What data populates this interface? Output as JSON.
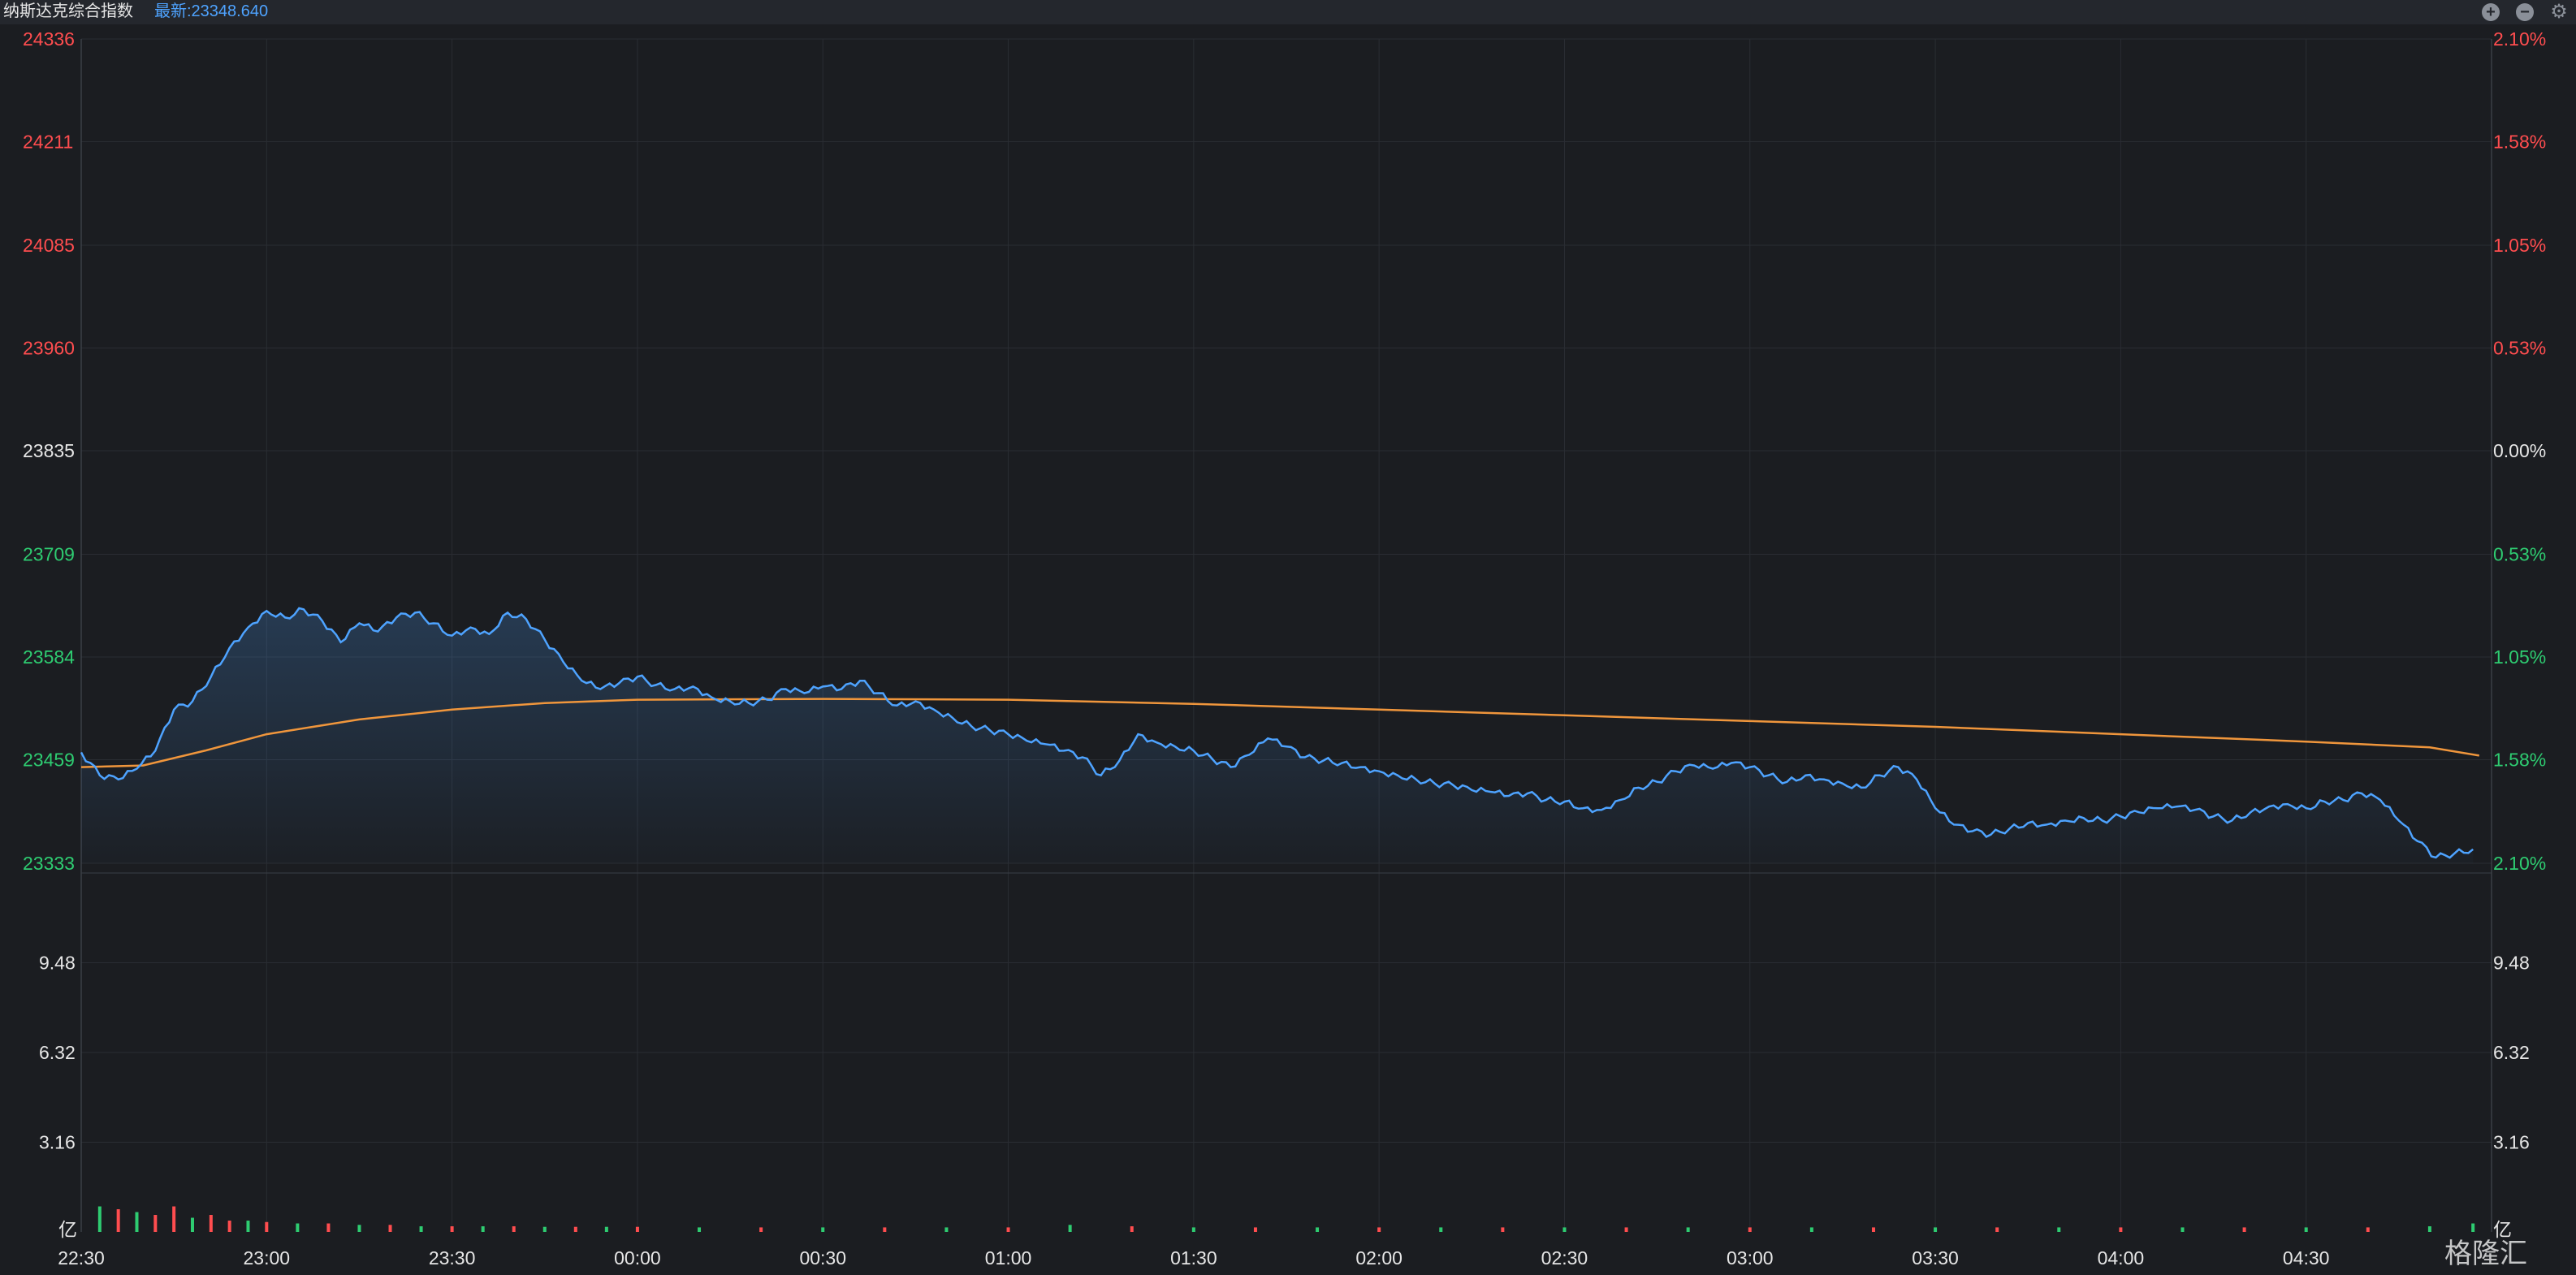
{
  "header": {
    "title": "纳斯达克综合指数",
    "latest_label": "最新:23348.640",
    "zoom_in_icon": "plus-circle-icon",
    "zoom_out_icon": "minus-circle-icon",
    "settings_icon": "gear-icon"
  },
  "colors": {
    "background": "#1b1d21",
    "price_line": "#4ea3ff",
    "avg_line": "#f0963c",
    "up": "#ff4d4f",
    "down": "#2ecc71",
    "neutral": "#e6e6e6",
    "grid": "#2a2d33"
  },
  "watermark": "格隆汇",
  "chart_data": [
    {
      "type": "line",
      "name": "price",
      "x_ticks": [
        "22:30",
        "23:00",
        "23:30",
        "00:00",
        "00:30",
        "01:00",
        "01:30",
        "02:00",
        "02:30",
        "03:00",
        "03:30",
        "04:00",
        "04:30"
      ],
      "x_range": [
        "22:30",
        "05:00"
      ],
      "y_ticks_left": [
        "24336",
        "24211",
        "24085",
        "23960",
        "23835",
        "23709",
        "23584",
        "23459",
        "23333"
      ],
      "y_ticks_right": [
        "2.10%",
        "1.58%",
        "1.05%",
        "0.53%",
        "0.00%",
        "0.53%",
        "1.05%",
        "1.58%",
        "2.10%"
      ],
      "ylim": [
        23333,
        24336
      ],
      "prev_close": 23835,
      "grid": true,
      "price_anchors": [
        [
          "22:30",
          23468
        ],
        [
          "22:33",
          23440
        ],
        [
          "22:36",
          23435
        ],
        [
          "22:39",
          23448
        ],
        [
          "22:42",
          23470
        ],
        [
          "22:45",
          23520
        ],
        [
          "22:48",
          23530
        ],
        [
          "22:51",
          23560
        ],
        [
          "22:54",
          23595
        ],
        [
          "22:57",
          23620
        ],
        [
          "23:00",
          23640
        ],
        [
          "23:03",
          23632
        ],
        [
          "23:06",
          23642
        ],
        [
          "23:09",
          23628
        ],
        [
          "23:12",
          23602
        ],
        [
          "23:15",
          23625
        ],
        [
          "23:18",
          23615
        ],
        [
          "23:21",
          23632
        ],
        [
          "23:24",
          23638
        ],
        [
          "23:27",
          23625
        ],
        [
          "23:30",
          23610
        ],
        [
          "23:33",
          23620
        ],
        [
          "23:36",
          23612
        ],
        [
          "23:39",
          23638
        ],
        [
          "23:42",
          23630
        ],
        [
          "23:45",
          23605
        ],
        [
          "23:48",
          23578
        ],
        [
          "23:51",
          23555
        ],
        [
          "23:54",
          23545
        ],
        [
          "23:57",
          23552
        ],
        [
          "00:00",
          23560
        ],
        [
          "00:03",
          23550
        ],
        [
          "00:06",
          23545
        ],
        [
          "00:09",
          23548
        ],
        [
          "00:12",
          23535
        ],
        [
          "00:15",
          23530
        ],
        [
          "00:18",
          23528
        ],
        [
          "00:21",
          23532
        ],
        [
          "00:24",
          23545
        ],
        [
          "00:27",
          23540
        ],
        [
          "00:30",
          23548
        ],
        [
          "00:33",
          23545
        ],
        [
          "00:36",
          23555
        ],
        [
          "00:39",
          23540
        ],
        [
          "00:42",
          23525
        ],
        [
          "00:45",
          23530
        ],
        [
          "00:48",
          23520
        ],
        [
          "00:51",
          23510
        ],
        [
          "00:54",
          23500
        ],
        [
          "00:57",
          23495
        ],
        [
          "01:00",
          23490
        ],
        [
          "01:03",
          23482
        ],
        [
          "01:06",
          23478
        ],
        [
          "01:09",
          23470
        ],
        [
          "01:12",
          23462
        ],
        [
          "01:15",
          23440
        ],
        [
          "01:18",
          23458
        ],
        [
          "01:21",
          23490
        ],
        [
          "01:24",
          23480
        ],
        [
          "01:27",
          23475
        ],
        [
          "01:30",
          23470
        ],
        [
          "01:33",
          23460
        ],
        [
          "01:36",
          23450
        ],
        [
          "01:39",
          23465
        ],
        [
          "01:42",
          23485
        ],
        [
          "01:45",
          23475
        ],
        [
          "01:48",
          23462
        ],
        [
          "01:51",
          23458
        ],
        [
          "01:54",
          23455
        ],
        [
          "01:57",
          23450
        ],
        [
          "02:00",
          23445
        ],
        [
          "02:03",
          23440
        ],
        [
          "02:06",
          23435
        ],
        [
          "02:09",
          23430
        ],
        [
          "02:12",
          23428
        ],
        [
          "02:15",
          23422
        ],
        [
          "02:18",
          23420
        ],
        [
          "02:21",
          23415
        ],
        [
          "02:24",
          23418
        ],
        [
          "02:27",
          23410
        ],
        [
          "02:30",
          23408
        ],
        [
          "02:33",
          23400
        ],
        [
          "02:36",
          23398
        ],
        [
          "02:39",
          23410
        ],
        [
          "02:42",
          23425
        ],
        [
          "02:45",
          23432
        ],
        [
          "02:48",
          23445
        ],
        [
          "02:51",
          23452
        ],
        [
          "02:54",
          23448
        ],
        [
          "02:57",
          23455
        ],
        [
          "03:00",
          23450
        ],
        [
          "03:03",
          23440
        ],
        [
          "03:06",
          23432
        ],
        [
          "03:09",
          23440
        ],
        [
          "03:12",
          23435
        ],
        [
          "03:15",
          23430
        ],
        [
          "03:18",
          23425
        ],
        [
          "03:21",
          23440
        ],
        [
          "03:24",
          23450
        ],
        [
          "03:27",
          23435
        ],
        [
          "03:30",
          23400
        ],
        [
          "03:33",
          23380
        ],
        [
          "03:36",
          23372
        ],
        [
          "03:39",
          23368
        ],
        [
          "03:42",
          23375
        ],
        [
          "03:45",
          23382
        ],
        [
          "03:48",
          23380
        ],
        [
          "03:51",
          23385
        ],
        [
          "03:54",
          23388
        ],
        [
          "03:57",
          23385
        ],
        [
          "04:00",
          23390
        ],
        [
          "04:03",
          23395
        ],
        [
          "04:06",
          23400
        ],
        [
          "04:09",
          23402
        ],
        [
          "04:12",
          23398
        ],
        [
          "04:15",
          23390
        ],
        [
          "04:18",
          23385
        ],
        [
          "04:21",
          23395
        ],
        [
          "04:24",
          23402
        ],
        [
          "04:27",
          23405
        ],
        [
          "04:30",
          23400
        ],
        [
          "04:33",
          23408
        ],
        [
          "04:36",
          23410
        ],
        [
          "04:39",
          23418
        ],
        [
          "04:42",
          23410
        ],
        [
          "04:45",
          23385
        ],
        [
          "04:48",
          23360
        ],
        [
          "04:51",
          23340
        ],
        [
          "04:54",
          23345
        ],
        [
          "04:57",
          23350
        ]
      ],
      "avg_anchors": [
        [
          "22:30",
          23450
        ],
        [
          "22:40",
          23452
        ],
        [
          "22:50",
          23470
        ],
        [
          "23:00",
          23490
        ],
        [
          "23:15",
          23508
        ],
        [
          "23:30",
          23520
        ],
        [
          "23:45",
          23528
        ],
        [
          "00:00",
          23532
        ],
        [
          "00:30",
          23533
        ],
        [
          "01:00",
          23532
        ],
        [
          "01:30",
          23527
        ],
        [
          "02:00",
          23520
        ],
        [
          "02:30",
          23513
        ],
        [
          "03:00",
          23506
        ],
        [
          "03:30",
          23499
        ],
        [
          "04:00",
          23490
        ],
        [
          "04:30",
          23481
        ],
        [
          "04:50",
          23474
        ],
        [
          "04:58",
          23464
        ]
      ]
    },
    {
      "type": "bar",
      "name": "volume",
      "unit": "亿",
      "y_ticks": [
        "9.48",
        "6.32",
        "3.16",
        "亿"
      ],
      "ylim": [
        0,
        12.64
      ],
      "x_range": [
        "22:30",
        "05:00"
      ],
      "bars": [
        [
          "22:33",
          0.9,
          "down"
        ],
        [
          "22:36",
          0.8,
          "up"
        ],
        [
          "22:39",
          0.7,
          "down"
        ],
        [
          "22:42",
          0.6,
          "up"
        ],
        [
          "22:45",
          0.9,
          "up"
        ],
        [
          "22:48",
          0.5,
          "down"
        ],
        [
          "22:51",
          0.6,
          "up"
        ],
        [
          "22:54",
          0.4,
          "up"
        ],
        [
          "22:57",
          0.4,
          "down"
        ],
        [
          "23:00",
          0.35,
          "up"
        ],
        [
          "23:05",
          0.3,
          "down"
        ],
        [
          "23:10",
          0.3,
          "up"
        ],
        [
          "23:15",
          0.25,
          "down"
        ],
        [
          "23:20",
          0.25,
          "up"
        ],
        [
          "23:25",
          0.2,
          "down"
        ],
        [
          "23:30",
          0.2,
          "up"
        ],
        [
          "23:35",
          0.2,
          "down"
        ],
        [
          "23:40",
          0.2,
          "up"
        ],
        [
          "23:45",
          0.18,
          "down"
        ],
        [
          "23:50",
          0.18,
          "up"
        ],
        [
          "23:55",
          0.18,
          "down"
        ],
        [
          "00:00",
          0.18,
          "up"
        ],
        [
          "00:10",
          0.16,
          "down"
        ],
        [
          "00:20",
          0.16,
          "up"
        ],
        [
          "00:30",
          0.16,
          "down"
        ],
        [
          "00:40",
          0.16,
          "up"
        ],
        [
          "00:50",
          0.16,
          "down"
        ],
        [
          "01:00",
          0.16,
          "up"
        ],
        [
          "01:10",
          0.25,
          "down"
        ],
        [
          "01:20",
          0.2,
          "up"
        ],
        [
          "01:30",
          0.16,
          "down"
        ],
        [
          "01:40",
          0.16,
          "up"
        ],
        [
          "01:50",
          0.16,
          "down"
        ],
        [
          "02:00",
          0.16,
          "up"
        ],
        [
          "02:10",
          0.16,
          "down"
        ],
        [
          "02:20",
          0.16,
          "up"
        ],
        [
          "02:30",
          0.16,
          "down"
        ],
        [
          "02:40",
          0.16,
          "up"
        ],
        [
          "02:50",
          0.16,
          "down"
        ],
        [
          "03:00",
          0.16,
          "up"
        ],
        [
          "03:10",
          0.16,
          "down"
        ],
        [
          "03:20",
          0.16,
          "up"
        ],
        [
          "03:30",
          0.16,
          "down"
        ],
        [
          "03:40",
          0.16,
          "up"
        ],
        [
          "03:50",
          0.16,
          "down"
        ],
        [
          "04:00",
          0.16,
          "up"
        ],
        [
          "04:10",
          0.16,
          "down"
        ],
        [
          "04:20",
          0.16,
          "up"
        ],
        [
          "04:30",
          0.16,
          "down"
        ],
        [
          "04:40",
          0.16,
          "up"
        ],
        [
          "04:50",
          0.2,
          "down"
        ],
        [
          "04:57",
          0.3,
          "down"
        ]
      ]
    }
  ]
}
